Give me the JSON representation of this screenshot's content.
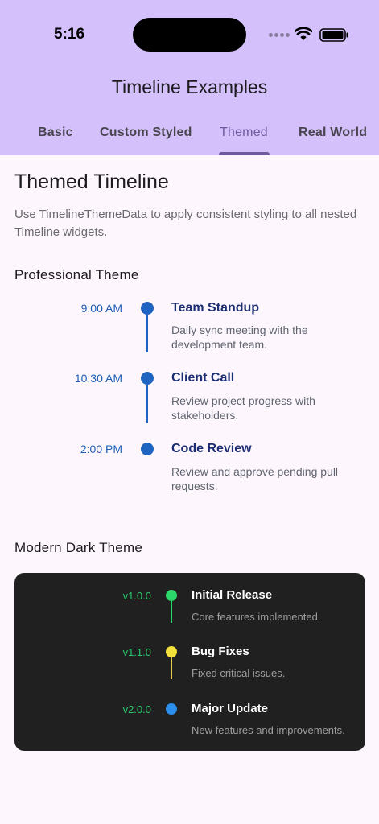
{
  "status_bar": {
    "time": "5:16"
  },
  "app": {
    "title": "Timeline Examples"
  },
  "tabs": [
    {
      "label": "Basic"
    },
    {
      "label": "Custom Styled"
    },
    {
      "label": "Themed"
    },
    {
      "label": "Real World"
    }
  ],
  "active_tab": "Themed",
  "section": {
    "title": "Themed Timeline",
    "description": "Use TimelineThemeData to apply consistent styling to all nested Timeline widgets."
  },
  "professional": {
    "heading": "Professional Theme",
    "accent": "#1f64c0",
    "items": [
      {
        "time": "9:00 AM",
        "title": "Team Standup",
        "detail": "Daily sync meeting with the development team."
      },
      {
        "time": "10:30 AM",
        "title": "Client Call",
        "detail": "Review project progress with stakeholders."
      },
      {
        "time": "2:00 PM",
        "title": "Code Review",
        "detail": "Review and approve pending pull requests."
      }
    ]
  },
  "dark": {
    "heading": "Modern Dark Theme",
    "background": "#202020",
    "items": [
      {
        "version": "v1.0.0",
        "title": "Initial Release",
        "detail": "Core features implemented.",
        "color": "#2bd96b"
      },
      {
        "version": "v1.1.0",
        "title": "Bug Fixes",
        "detail": "Fixed critical issues.",
        "color": "#f3e03b"
      },
      {
        "version": "v2.0.0",
        "title": "Major Update",
        "detail": "New features and improvements.",
        "color": "#2b8ff0"
      }
    ]
  }
}
